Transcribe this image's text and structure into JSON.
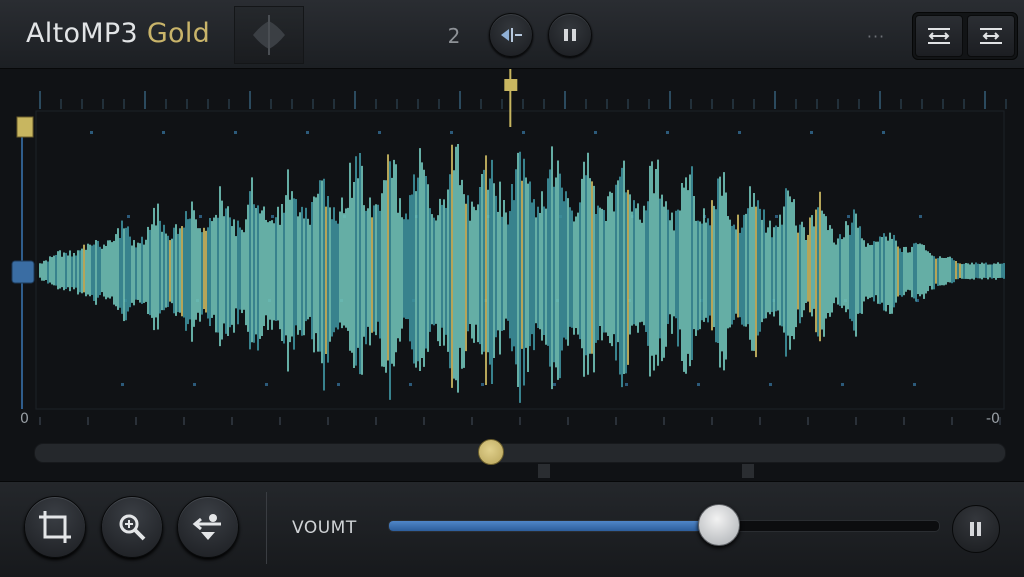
{
  "app": {
    "title_main": "AltoMP3",
    "title_accent": "Gold",
    "accent_color": "#c9b46a"
  },
  "toolbar": {
    "counter": "2",
    "more_label": "···",
    "icons": [
      "waveform-thumbnail",
      "split-icon",
      "pause-icon",
      "more-icon",
      "fit-width-icon",
      "expand-width-icon"
    ]
  },
  "waveform": {
    "start_label": "0",
    "end_label": "-0",
    "playhead_position": 0.49,
    "scrub_position": 0.47,
    "colors": {
      "wave": "#6fc0b5",
      "wave_dark": "#3d8f9a",
      "highlight": "#c8b660",
      "grid": "#2b4a5e"
    }
  },
  "volume": {
    "label": "VOUMT",
    "level": 0.6,
    "fill_color": "#3f76b8"
  },
  "bottom_tools": {
    "icons": [
      "crop-icon",
      "zoom-icon",
      "share-icon",
      "pause-icon"
    ]
  }
}
